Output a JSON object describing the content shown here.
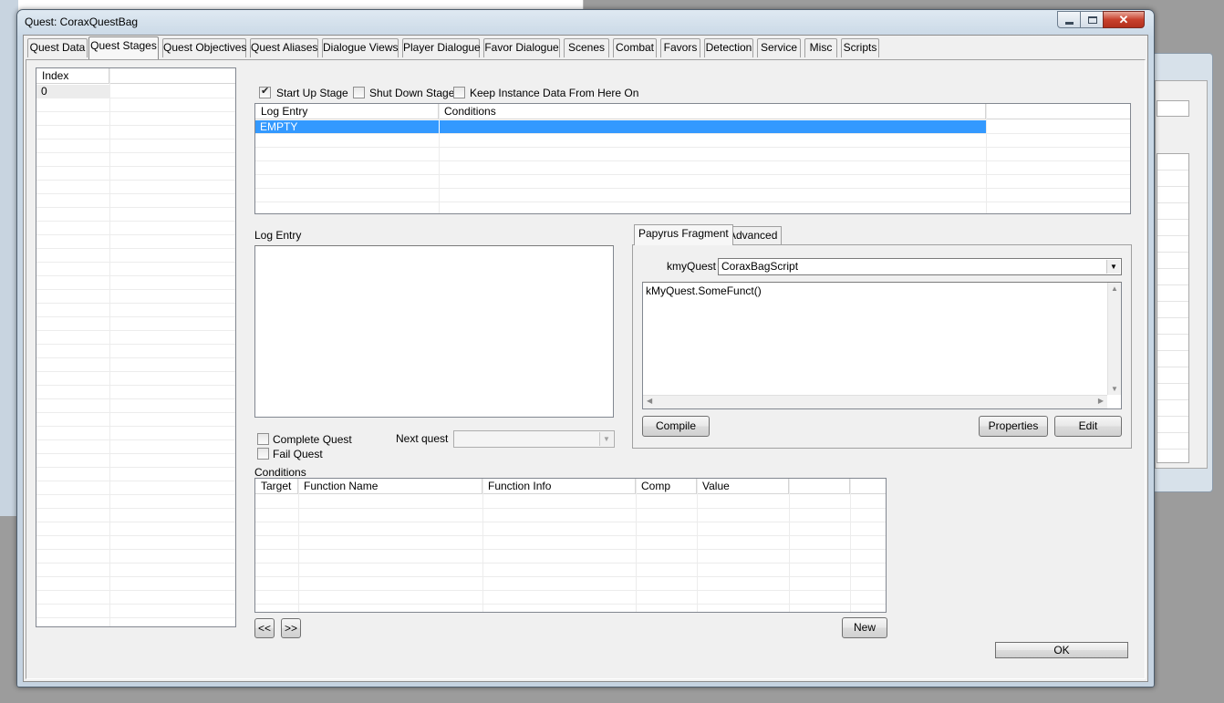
{
  "window": {
    "title": "Quest: CoraxQuestBag",
    "close_glyph": "✕"
  },
  "tabs": [
    {
      "label": "Quest Data"
    },
    {
      "label": "Quest Stages"
    },
    {
      "label": "Quest Objectives"
    },
    {
      "label": "Quest Aliases"
    },
    {
      "label": "Dialogue Views"
    },
    {
      "label": "Player Dialogue"
    },
    {
      "label": "Favor Dialogue"
    },
    {
      "label": "Scenes"
    },
    {
      "label": "Combat"
    },
    {
      "label": "Favors"
    },
    {
      "label": "Detection"
    },
    {
      "label": "Service"
    },
    {
      "label": "Misc"
    },
    {
      "label": "Scripts"
    }
  ],
  "active_tab": "Quest Stages",
  "index_list": {
    "header": "Index",
    "rows": [
      "0"
    ]
  },
  "stage_flags": {
    "start_up": {
      "label": "Start Up Stage",
      "checked": true
    },
    "shut_down": {
      "label": "Shut Down Stage",
      "checked": false
    },
    "keep_instance": {
      "label": "Keep Instance Data From Here On",
      "checked": false
    }
  },
  "log_table": {
    "headers": [
      "Log Entry",
      "Conditions"
    ],
    "rows": [
      {
        "log_entry": "EMPTY",
        "conditions": "",
        "selected": true
      }
    ]
  },
  "log_entry_label": "Log Entry",
  "log_entry_text": "",
  "complete_quest": {
    "label": "Complete Quest",
    "checked": false
  },
  "fail_quest": {
    "label": "Fail Quest",
    "checked": false
  },
  "next_quest": {
    "label": "Next quest",
    "value": ""
  },
  "fragment": {
    "tabs": [
      "Papyrus Fragment",
      "Advanced"
    ],
    "property_label": "kmyQuest",
    "property_value": "CoraxBagScript",
    "code": "kMyQuest.SomeFunct()",
    "compile_label": "Compile",
    "properties_label": "Properties",
    "edit_label": "Edit"
  },
  "conditions": {
    "label": "Conditions",
    "headers": [
      "Target",
      "Function Name",
      "Function Info",
      "Comp",
      "Value",
      "",
      ""
    ],
    "prev_label": "<<",
    "next_label": ">>",
    "new_label": "New"
  },
  "ok_label": "OK",
  "colors": {
    "selection": "#3399ff",
    "accent_close": "#c8412d"
  }
}
